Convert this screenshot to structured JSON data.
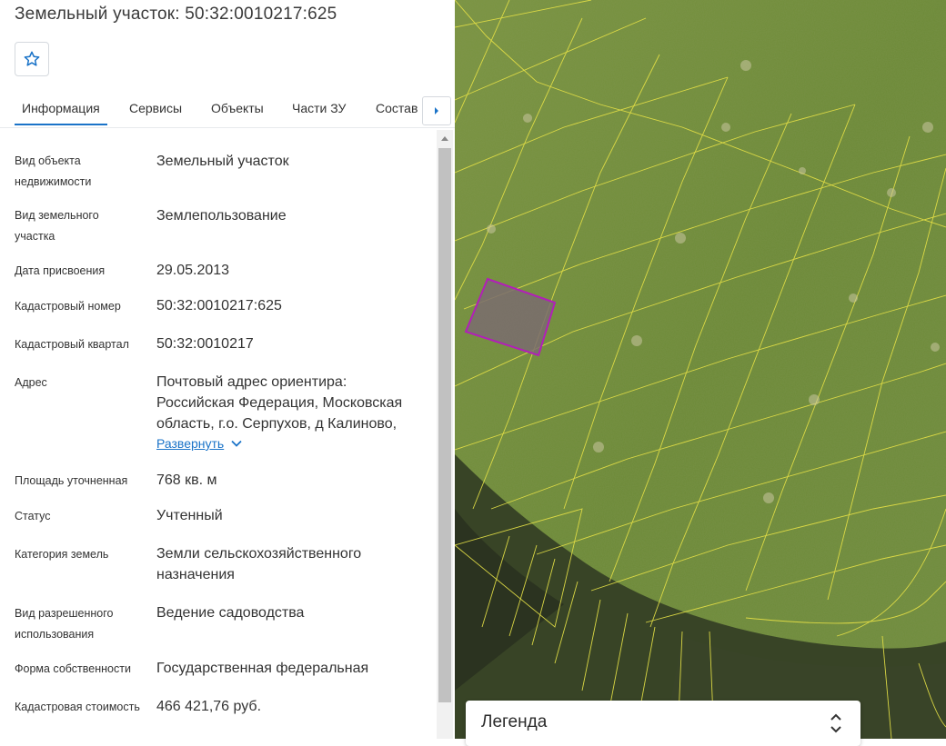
{
  "title": "Земельный участок: 50:32:0010217:625",
  "favorite": {
    "icon": "star-outline-icon"
  },
  "tabs": [
    {
      "label": "Информация",
      "active": true
    },
    {
      "label": "Сервисы"
    },
    {
      "label": "Объекты"
    },
    {
      "label": "Части ЗУ"
    },
    {
      "label": "Состав"
    }
  ],
  "info": [
    {
      "label": "Вид объекта недвижимости",
      "value": "Земельный участок"
    },
    {
      "label": "Вид земельного участка",
      "value": "Землепользование"
    },
    {
      "label": "Дата присвоения",
      "value": "29.05.2013"
    },
    {
      "label": "Кадастровый номер",
      "value": "50:32:0010217:625"
    },
    {
      "label": "Кадастровый квартал",
      "value": "50:32:0010217"
    },
    {
      "label": "Адрес",
      "value": "Почтовый адрес ориентира: Российская Федерация, Московская область, г.о. Серпухов, д Калиново,"
    },
    {
      "label": "Площадь уточненная",
      "value": "768 кв. м"
    },
    {
      "label": "Статус",
      "value": "Учтенный"
    },
    {
      "label": "Категория земель",
      "value": "Земли сельскохозяйственного назначения"
    },
    {
      "label": "Вид разрешенного использования",
      "value": "Ведение садоводства"
    },
    {
      "label": "Форма собственности",
      "value": "Государственная федеральная"
    },
    {
      "label": "Кадастровая стоимость",
      "value": "466 421,76 руб."
    }
  ],
  "expand_label": "Развернуть",
  "legend": {
    "label": "Легенда"
  },
  "colors": {
    "accent": "#1a73c8",
    "parcel_highlight": "#b21fb8",
    "boundary": "#e8e04a",
    "field": "#6f8a38"
  }
}
